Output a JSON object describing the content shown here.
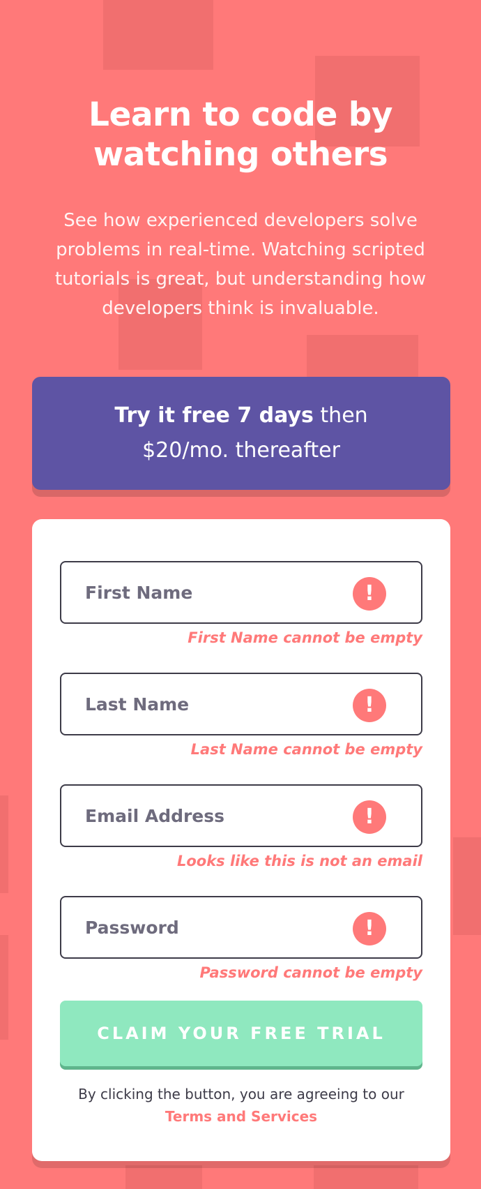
{
  "hero": {
    "title": "Learn to code by watching others",
    "description": "See how experienced developers solve problems in real-time. Watching scripted tutorials is great, but understanding how developers think is invaluable."
  },
  "promo": {
    "bold": "Try it free 7 days",
    "rest_1": " then",
    "rest_2": "$20/mo. thereafter"
  },
  "form": {
    "fields": [
      {
        "placeholder": "First Name",
        "error": "First Name cannot be empty"
      },
      {
        "placeholder": "Last Name",
        "error": "Last Name cannot be empty"
      },
      {
        "placeholder": "Email Address",
        "error": "Looks like this is not an email"
      },
      {
        "placeholder": "Password",
        "error": "Password cannot be empty"
      }
    ],
    "error_icon_glyph": "!",
    "submit_label": "CLAIM YOUR FREE TRIAL",
    "terms_prefix": "By clicking the button, you are agreeing to our",
    "terms_link": "Terms and Services"
  },
  "colors": {
    "background": "#ff7979",
    "promo": "#5e54a4",
    "submit": "#8fe8bf",
    "error": "#ff7979",
    "text_dark": "#3d3b48"
  }
}
